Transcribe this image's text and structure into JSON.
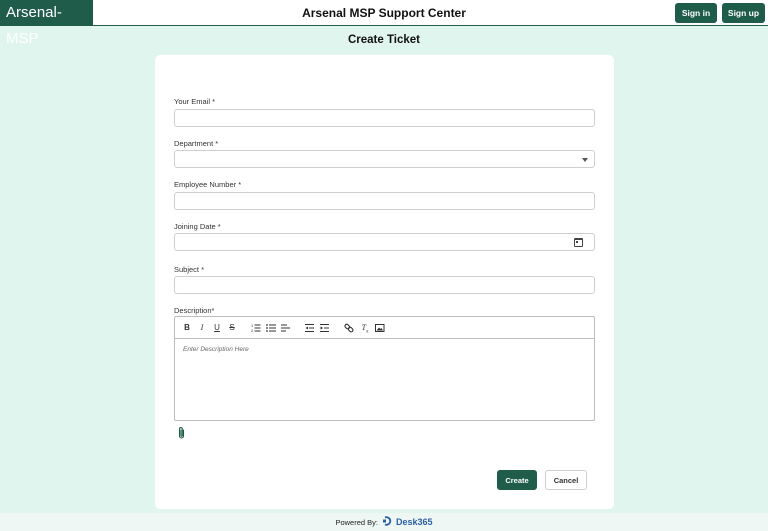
{
  "header": {
    "logo": "Arsenal-MSP",
    "title": "Arsenal MSP Support Center",
    "signin_label": "Sign in",
    "signup_label": "Sign up"
  },
  "page_title": "Create Ticket",
  "form": {
    "email_label": "Your Email *",
    "email_value": "",
    "department_label": "Department *",
    "department_value": "",
    "employee_number_label": "Employee Number *",
    "employee_number_value": "",
    "joining_date_label": "Joining Date *",
    "joining_date_value": "",
    "subject_label": "Subject *",
    "subject_value": "",
    "description_label": "Description*",
    "description_placeholder": "Enter Description Here",
    "toolbar": [
      "bold",
      "italic",
      "underline",
      "strikethrough",
      "ordered-list",
      "bullet-list",
      "align",
      "outdent",
      "indent",
      "link",
      "clear-format",
      "image"
    ],
    "create_label": "Create",
    "cancel_label": "Cancel"
  },
  "footer": {
    "powered_by": "Powered By:",
    "brand": "Desk365"
  },
  "colors": {
    "primary": "#1f5c4a",
    "background": "#dff5ee",
    "brand_blue": "#2d5fa8"
  }
}
